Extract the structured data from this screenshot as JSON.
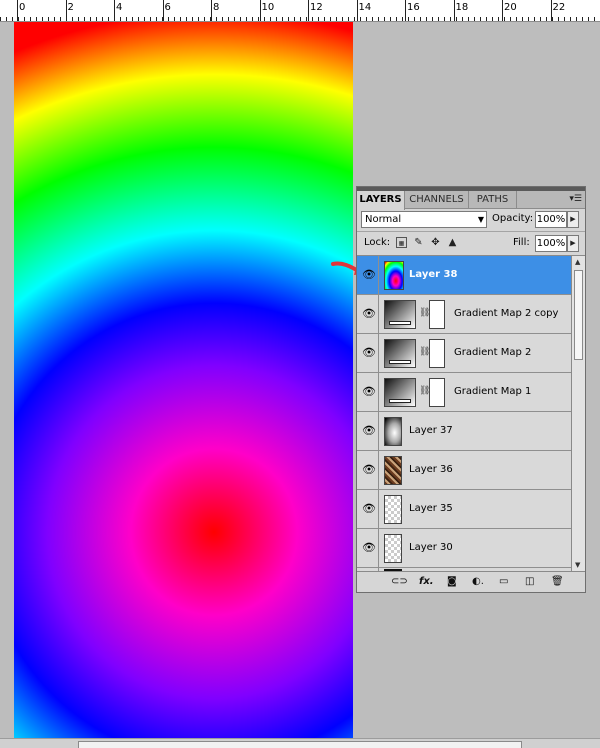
{
  "ruler": {
    "numbers": [
      "0",
      "2",
      "4",
      "6",
      "8",
      "10",
      "12",
      "14",
      "16",
      "18",
      "20",
      "22"
    ]
  },
  "layers_panel": {
    "tabs": [
      {
        "label": "LAYERS",
        "active": true
      },
      {
        "label": "CHANNELS",
        "active": false
      },
      {
        "label": "PATHS",
        "active": false
      }
    ],
    "menu_icon": "panel-menu-icon",
    "blend_mode": "Normal",
    "opacity_label": "Opacity:",
    "opacity_value": "100%",
    "lock_label": "Lock:",
    "fill_label": "Fill:",
    "fill_value": "100%",
    "layers": [
      {
        "name": "Layer 38",
        "selected": true,
        "visible": true,
        "thumb": "rainbow-gradient",
        "mask": false
      },
      {
        "name": "Gradient Map 2 copy",
        "selected": false,
        "visible": true,
        "thumb": "gradient-map-adjustment",
        "mask": true
      },
      {
        "name": "Gradient Map 2",
        "selected": false,
        "visible": true,
        "thumb": "gradient-map-adjustment",
        "mask": true
      },
      {
        "name": "Gradient Map 1",
        "selected": false,
        "visible": true,
        "thumb": "gradient-map-adjustment",
        "mask": true
      },
      {
        "name": "Layer 37",
        "selected": false,
        "visible": true,
        "thumb": "radial-white",
        "mask": false
      },
      {
        "name": "Layer 36",
        "selected": false,
        "visible": true,
        "thumb": "photo-texture",
        "mask": false
      },
      {
        "name": "Layer 35",
        "selected": false,
        "visible": true,
        "thumb": "transparent",
        "mask": false
      },
      {
        "name": "Layer 30",
        "selected": false,
        "visible": true,
        "thumb": "transparent",
        "mask": false
      }
    ],
    "bottom_icons": [
      "link-layers-icon",
      "fx-icon",
      "add-mask-icon",
      "adjustment-layer-icon",
      "new-group-icon",
      "new-layer-icon",
      "trash-icon"
    ]
  },
  "colors": {
    "selected_row": "#3d8fe6",
    "panel_bg": "#d6d6d6",
    "annotation_arrow": "#e0343a"
  }
}
